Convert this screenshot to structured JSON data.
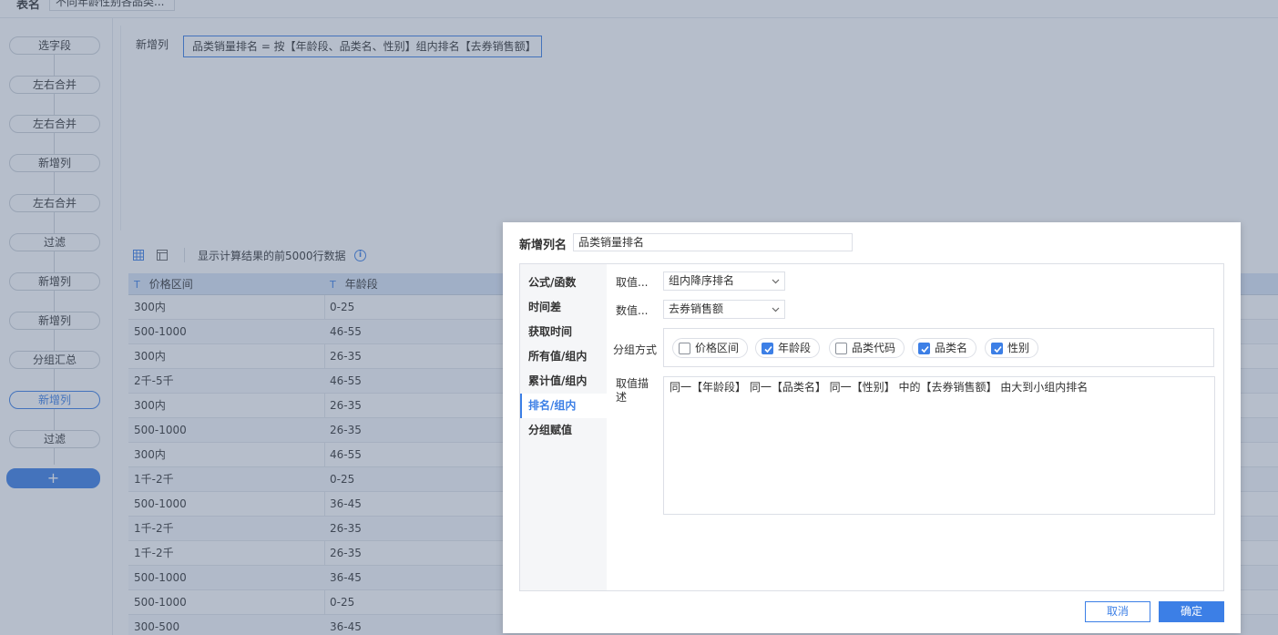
{
  "topbar": {
    "table_name_label": "表名",
    "table_name_value": "不同年龄性别各品类..."
  },
  "steps": [
    "选字段",
    "左右合并",
    "左右合并",
    "新增列",
    "左右合并",
    "过滤",
    "新增列",
    "新增列",
    "分组汇总",
    "新增列",
    "过滤"
  ],
  "steps_active_index": 9,
  "add_step_label": "+",
  "formula": {
    "label": "新增列",
    "expression": "品类销量排名 = 按【年龄段、品类名、性别】组内排名【去券销售额】"
  },
  "table_toolbar": {
    "preview_text": "显示计算结果的前5000行数据",
    "info_label": "i"
  },
  "table": {
    "type_badge": "T",
    "columns": [
      "价格区间",
      "年龄段"
    ],
    "rows": [
      [
        "300内",
        "0-25"
      ],
      [
        "500-1000",
        "46-55"
      ],
      [
        "300内",
        "26-35"
      ],
      [
        "2千-5千",
        "46-55"
      ],
      [
        "300内",
        "26-35"
      ],
      [
        "500-1000",
        "26-35"
      ],
      [
        "300内",
        "46-55"
      ],
      [
        "1千-2千",
        "0-25"
      ],
      [
        "500-1000",
        "36-45"
      ],
      [
        "1千-2千",
        "26-35"
      ],
      [
        "1千-2千",
        "26-35"
      ],
      [
        "500-1000",
        "36-45"
      ],
      [
        "500-1000",
        "0-25"
      ],
      [
        "300-500",
        "36-45"
      ]
    ]
  },
  "dialog": {
    "name_label": "新增列名",
    "name_value": "品类销量排名",
    "menu": [
      "公式/函数",
      "时间差",
      "获取时间",
      "所有值/组内",
      "累计值/组内",
      "排名/组内",
      "分组赋值"
    ],
    "menu_active_index": 5,
    "value_mode_label": "取值...",
    "value_mode_selected": "组内降序排名",
    "value_field_label": "数值...",
    "value_field_selected": "去券销售额",
    "group_label": "分组方式",
    "group_options": [
      {
        "label": "价格区间",
        "checked": false
      },
      {
        "label": "年龄段",
        "checked": true
      },
      {
        "label": "品类代码",
        "checked": false
      },
      {
        "label": "品类名",
        "checked": true
      },
      {
        "label": "性别",
        "checked": true
      }
    ],
    "desc_label": "取值描述",
    "desc_text": "同一【年龄段】 同一【品类名】 同一【性别】 中的【去券销售额】 由大到小组内排名",
    "cancel_label": "取消",
    "ok_label": "确定"
  },
  "colors": {
    "accent": "#3c7fe6",
    "header_bg": "#d9e6f7",
    "overlay": "rgba(80,100,130,0.42)"
  }
}
